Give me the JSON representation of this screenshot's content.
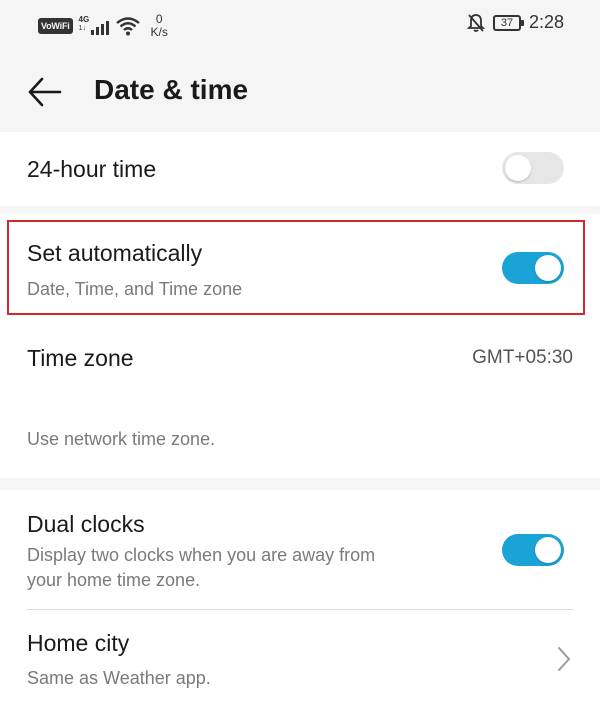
{
  "status_bar": {
    "vowifi": "VoWiFi",
    "network": "4G",
    "network_sub": "1↓",
    "speed_value": "0",
    "speed_unit": "K/s",
    "battery": "37",
    "time": "2:28",
    "icons": [
      "wifi-icon",
      "signal-icon",
      "bell-off-icon",
      "battery-icon"
    ]
  },
  "header": {
    "back_icon": "arrow-left-icon",
    "title": "Date & time"
  },
  "settings": {
    "hour24": {
      "title": "24-hour time",
      "enabled": false
    },
    "set_automatically": {
      "title": "Set automatically",
      "subtitle": "Date, Time, and Time zone",
      "enabled": true
    },
    "time_zone": {
      "title": "Time zone",
      "value": "GMT+05:30",
      "note": "Use network time zone."
    },
    "dual_clocks": {
      "title": "Dual clocks",
      "subtitle_line1": "Display two clocks when you are away from",
      "subtitle_line2": "your home time zone.",
      "enabled": true
    },
    "home_city": {
      "title": "Home city",
      "subtitle": "Same as Weather app."
    }
  },
  "colors": {
    "toggle_on": "#1aa3d6",
    "toggle_off": "#e6e6e6",
    "highlight": "#d0282e"
  }
}
